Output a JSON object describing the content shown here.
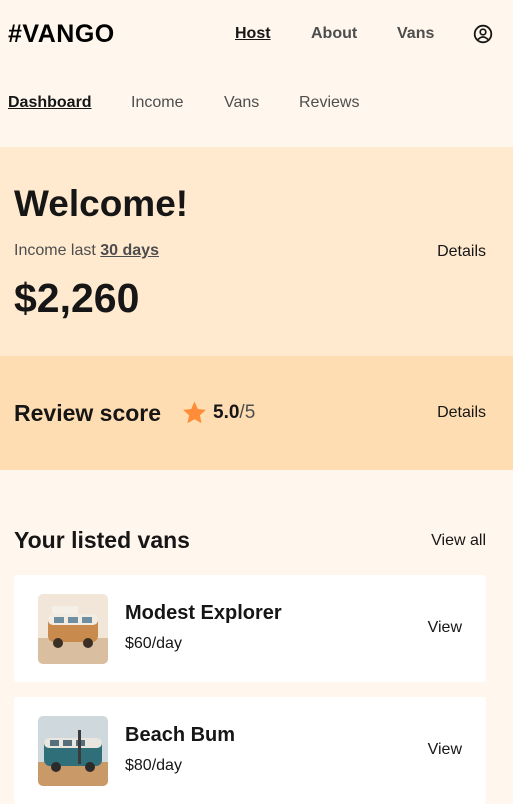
{
  "header": {
    "logo": "#VANGO",
    "nav": [
      "Host",
      "About",
      "Vans"
    ]
  },
  "subnav": [
    "Dashboard",
    "Income",
    "Vans",
    "Reviews"
  ],
  "welcome": {
    "title": "Welcome!",
    "income_prefix": "Income last ",
    "income_period": "30 days",
    "details_label": "Details",
    "amount": "$2,260"
  },
  "review": {
    "title": "Review score",
    "score": "5.0",
    "out_of": "/5",
    "details_label": "Details",
    "star_color": "#FF8C38"
  },
  "listed": {
    "title": "Your listed vans",
    "view_all": "View all",
    "vans": [
      {
        "name": "Modest Explorer",
        "price": "$60/day",
        "action": "View"
      },
      {
        "name": "Beach Bum",
        "price": "$80/day",
        "action": "View"
      }
    ]
  },
  "colors": {
    "page_bg": "#FFF7ED",
    "welcome_bg": "#FFEAD0",
    "review_bg": "#FFDDB2",
    "card_bg": "#FFFFFF"
  }
}
